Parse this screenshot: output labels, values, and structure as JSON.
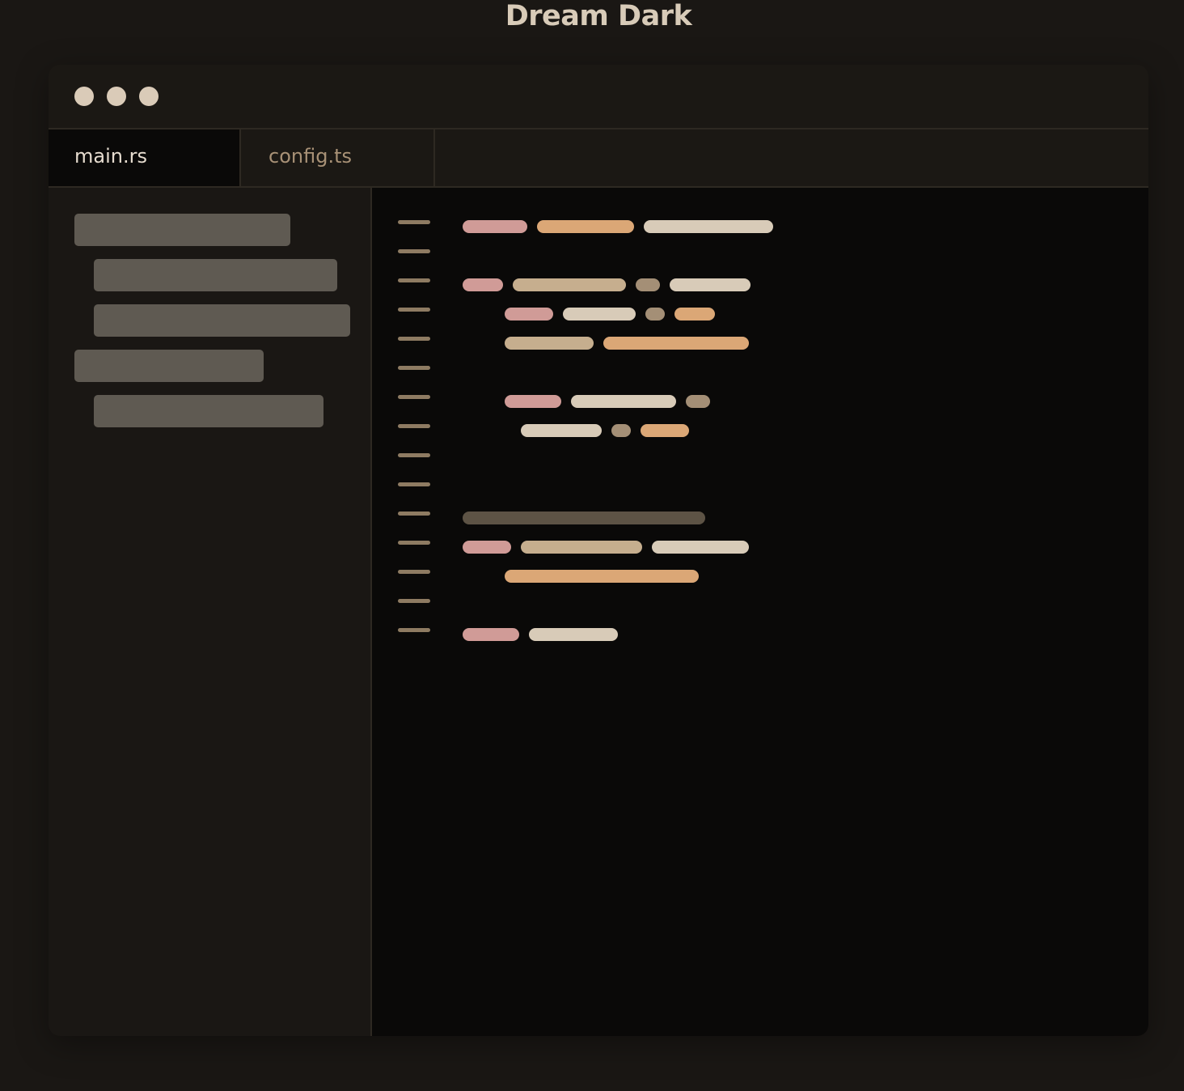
{
  "theme": {
    "title": "Dream Dark"
  },
  "colors": {
    "background": "#1a1714",
    "editor_background": "#0a0908",
    "keyword": "#d09b97",
    "type": "#c6ae8e",
    "punctuation": "#a48f76",
    "identifier": "#d8cbb8",
    "string": "#dba776",
    "comment": "#5d5345",
    "line_number": "#8e7b62",
    "tree_item": "#5f5a52",
    "window_control": "#dacbb8"
  },
  "window": {
    "controls": [
      {
        "name": "close-button"
      },
      {
        "name": "minimize-button"
      },
      {
        "name": "maximize-button"
      }
    ]
  },
  "tabs": [
    {
      "label": "main.rs",
      "active": true
    },
    {
      "label": "config.ts",
      "active": false
    }
  ],
  "sidebar": {
    "items": [
      {
        "depth": 0
      },
      {
        "depth": 1
      },
      {
        "depth": 1
      },
      {
        "depth": 0
      },
      {
        "depth": 1
      }
    ]
  },
  "editor": {
    "line_count": 15
  }
}
